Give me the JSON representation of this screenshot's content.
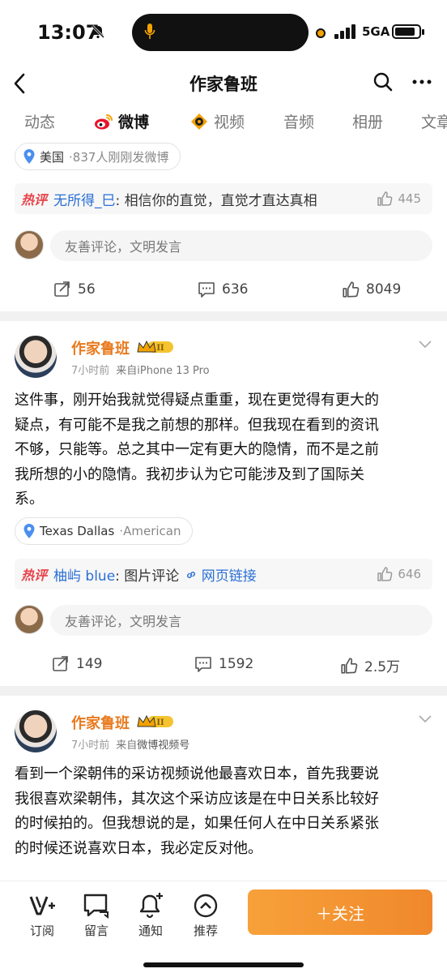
{
  "status": {
    "time": "13:07",
    "network": "5GA",
    "battery_percent": 85
  },
  "nav": {
    "title": "作家鲁班"
  },
  "tabs": [
    "动态",
    "微博",
    "视频",
    "音频",
    "相册",
    "文章"
  ],
  "posts": [
    {
      "location": {
        "place": "美国",
        "extra": "·837人刚刚发微博"
      },
      "hot_comment": {
        "tag": "热评",
        "user": "无所得_巳",
        "text": ": 相信你的直觉，直觉才直达真相",
        "link": "",
        "likes": "445"
      },
      "comment_placeholder": "友善评论，文明发言",
      "actions": {
        "reposts": "56",
        "comments": "636",
        "likes": "8049"
      }
    },
    {
      "author": "作家鲁班",
      "badge": "II",
      "time": "7小时前",
      "source": "来自iPhone 13 Pro",
      "lines": [
        "这件事，刚开始我就觉得疑点重重，现在更觉得有更大的",
        "疑点，有可能不是我之前想的那样。但我现在看到的资讯",
        "不够，只能等。总之其中一定有更大的隐情，而不是之前",
        "我所想的小的隐情。我初步认为它可能涉及到了国际关",
        "系。"
      ],
      "location": {
        "place": "Texas Dallas",
        "extra": "·American"
      },
      "hot_comment": {
        "tag": "热评",
        "user": "柚屿 blue",
        "text": ": 图片评论",
        "link": "网页链接",
        "likes": "646"
      },
      "comment_placeholder": "友善评论，文明发言",
      "actions": {
        "reposts": "149",
        "comments": "1592",
        "likes": "2.5万"
      }
    },
    {
      "author": "作家鲁班",
      "badge": "II",
      "time": "7小时前",
      "source_prefix": "来自",
      "source": "微博视频号",
      "lines": [
        "看到一个梁朝伟的采访视频说他最喜欢日本，首先我要说",
        "我很喜欢梁朝伟，其次这个采访应该是在中日关系比较好",
        "的时候拍的。但我想说的是，如果任何人在中日关系紧张",
        "的时候还说喜欢日本，我必定反对他。"
      ]
    }
  ],
  "bottom_bar": {
    "subscribe": "订阅",
    "message": "留言",
    "notify": "通知",
    "recommend": "推荐",
    "follow": "＋关注"
  },
  "colors": {
    "accent": "#f0882b",
    "username": "#e87a1e",
    "link": "#2a6fd6",
    "hot": "#e8434b"
  }
}
